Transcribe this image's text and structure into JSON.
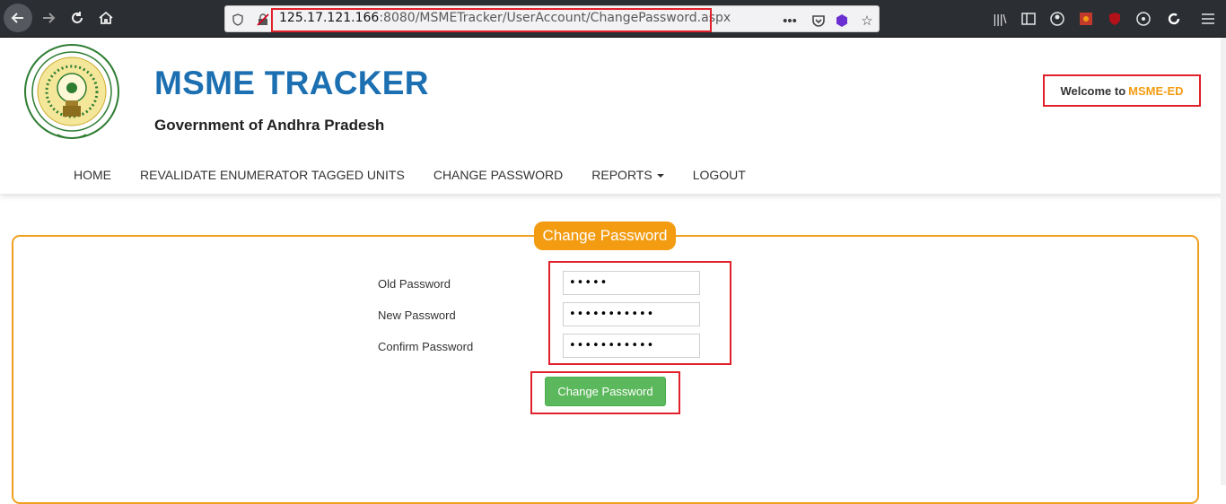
{
  "browser": {
    "url_host": "125.17.121.166",
    "url_path": ":8080/MSMETracker/UserAccount/ChangePassword.aspx"
  },
  "header": {
    "title": "MSME TRACKER",
    "subtitle": "Government of Andhra Pradesh",
    "welcome_prefix": "Welcome to",
    "welcome_user": "MSME-ED"
  },
  "menu": {
    "items": [
      {
        "label": "HOME"
      },
      {
        "label": "REVALIDATE ENUMERATOR TAGGED UNITS"
      },
      {
        "label": "CHANGE PASSWORD"
      },
      {
        "label": "REPORTS"
      },
      {
        "label": "LOGOUT"
      }
    ]
  },
  "form": {
    "legend": "Change Password",
    "fields": [
      {
        "label": "Old Password",
        "value": "•••••"
      },
      {
        "label": "New Password",
        "value": "•••••••••••"
      },
      {
        "label": "Confirm Password",
        "value": "•••••••••••"
      }
    ],
    "submit_label": "Change Password"
  },
  "colors": {
    "brand_blue": "#1c6fb1",
    "accent_orange": "#f39c12",
    "button_green": "#5cb85c",
    "highlight_red": "#e0202a"
  }
}
